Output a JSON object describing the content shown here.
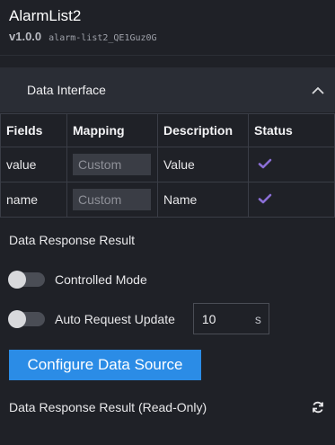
{
  "component": {
    "title": "AlarmList2",
    "version": "v1.0.0",
    "id": "alarm-list2_QE1Guz0G"
  },
  "data_interface": {
    "title": "Data Interface",
    "collapse_icon": "chevron-up-icon",
    "columns": [
      "Fields",
      "Mapping",
      "Description",
      "Status"
    ],
    "rows": [
      {
        "field": "value",
        "mapping": "Custom",
        "description": "Value",
        "status_icon": "check-icon"
      },
      {
        "field": "name",
        "mapping": "Custom",
        "description": "Name",
        "status_icon": "check-icon"
      }
    ]
  },
  "data_response_result": "Data Response Result",
  "controlled_mode": {
    "label": "Controlled Mode",
    "on": false
  },
  "auto_request": {
    "label": "Auto Request Update",
    "on": false,
    "interval": "10",
    "unit": "s"
  },
  "configure_button": "Configure Data Source",
  "read_only_result": {
    "label": "Data Response Result (Read-Only)",
    "icon": "refresh-icon"
  },
  "colors": {
    "background": "#1f2127",
    "section": "#2a2d35",
    "accent_blue": "#2b8ce6",
    "check_purple": "#8b6fd6"
  }
}
